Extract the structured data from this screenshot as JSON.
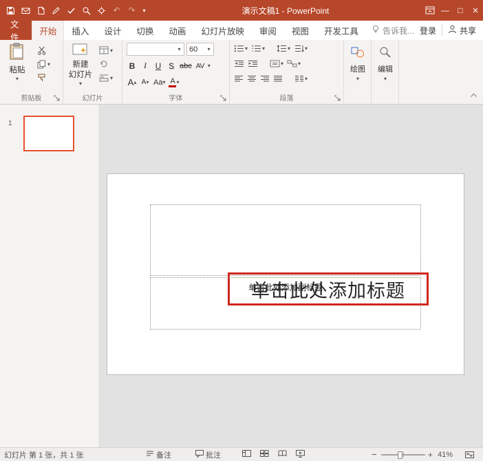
{
  "colors": {
    "titlebar": "#B7472A",
    "ribbon_bg": "#F5F3F1",
    "canvas_bg": "#E2E2E2",
    "thumb_border": "#E8502F",
    "highlight": "#D0261C",
    "font_color_bar": "#C00000"
  },
  "titlebar": {
    "title": "演示文稿1 - PowerPoint"
  },
  "tabs": {
    "file": "文件",
    "items": [
      "开始",
      "插入",
      "设计",
      "切换",
      "动画",
      "幻灯片放映",
      "审阅",
      "视图",
      "开发工具"
    ],
    "active": "开始",
    "tellme": "告诉我...",
    "signin": "登录",
    "share": "共享"
  },
  "ribbon": {
    "clipboard": {
      "paste": "粘贴",
      "label": "剪贴板"
    },
    "slides": {
      "new1": "新建",
      "new2": "幻灯片",
      "label": "幻灯片"
    },
    "font": {
      "label": "字体",
      "name_value": "",
      "size_value": "60",
      "bold": "B",
      "italic": "I",
      "underline": "U",
      "shadow": "S",
      "strikethrough": "abc",
      "char_spacing": "AV",
      "grow": "A",
      "shrink": "A",
      "change_case": "Aa",
      "font_color": "A"
    },
    "paragraph": {
      "label": "段落"
    },
    "drawing": {
      "label": "绘图"
    },
    "editing": {
      "label": "编辑"
    }
  },
  "slide_panel": {
    "slide_number": "1"
  },
  "slide": {
    "title_placeholder": "单击此处添加标题",
    "subtitle_placeholder": "单击此处添加副标题"
  },
  "statusbar": {
    "slide_info": "幻灯片 第 1 张，共 1 张",
    "notes": "备注",
    "comments": "批注",
    "zoom_out": "−",
    "zoom_in": "+",
    "zoom": "41%"
  },
  "icons": {
    "dropdown": "▾",
    "up_small": "▴",
    "undo": "↶",
    "redo": "↷",
    "minimize": "—",
    "maximize": "□",
    "close": "×"
  }
}
